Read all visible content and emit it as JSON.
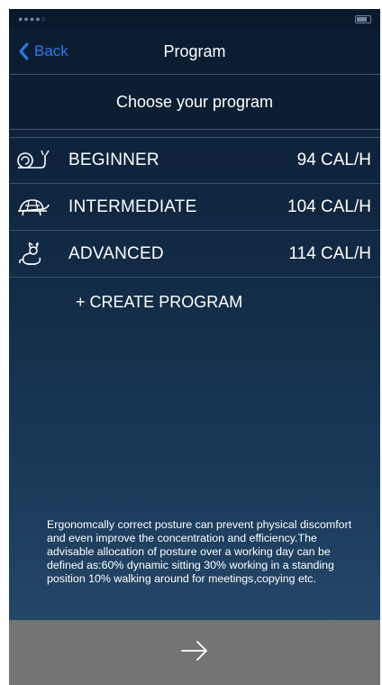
{
  "nav": {
    "back_label": "Back",
    "title": "Program"
  },
  "subtitle": "Choose your program",
  "programs": [
    {
      "icon": "snail-icon",
      "label": "BEGINNER",
      "calories": "94 CAL/H"
    },
    {
      "icon": "turtle-icon",
      "label": "INTERMEDIATE",
      "calories": "104 CAL/H"
    },
    {
      "icon": "rabbit-icon",
      "label": "ADVANCED",
      "calories": "114 CAL/H"
    }
  ],
  "create_label": "+ CREATE PROGRAM",
  "info_text": "Ergonomcally correct posture can prevent physical discomfort and even improve the concentration and efficiency.The advisable allocation of posture over a working day can be defined as:60% dynamic sitting 30% working in a standing position 10% walking around for meetings,copying etc.",
  "footer": {
    "icon": "arrow-right-icon"
  },
  "colors": {
    "accent": "#2d7bf0",
    "background_top": "#0b1c30",
    "background_bottom": "#2a4d6e",
    "footer": "#747474"
  }
}
